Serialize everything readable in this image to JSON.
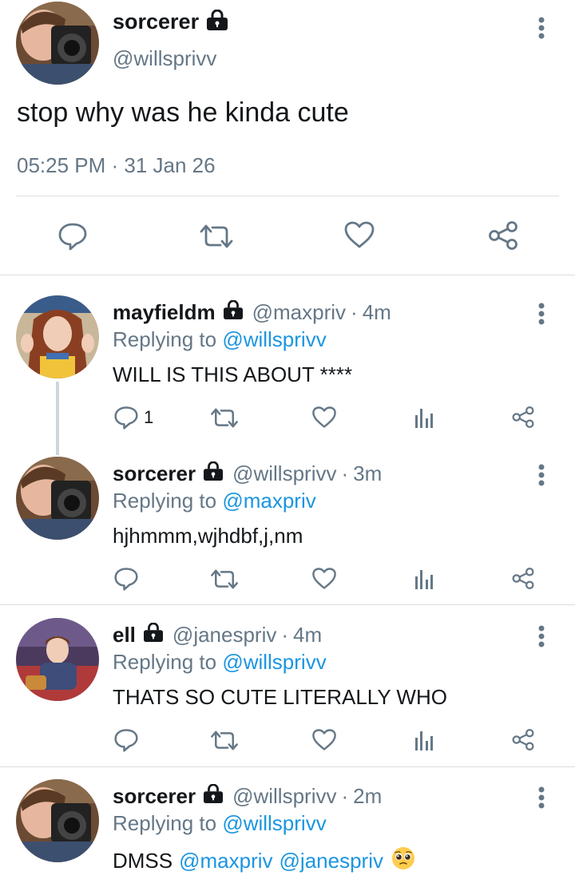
{
  "main_tweet": {
    "name": "sorcerer",
    "handle": "@willsprivv",
    "text": "stop why was he kinda cute",
    "timestamp": "05:25 PM · 31 Jan 26",
    "icons": [
      "lock-icon",
      "more-icon",
      "reply-icon",
      "retweet-icon",
      "like-icon",
      "share-icon"
    ]
  },
  "replies": [
    {
      "name": "mayfieldm",
      "handle": "@maxpriv",
      "dot": "·",
      "ago": "4m",
      "replying_prefix": "Replying to",
      "replying_to": "@willsprivv",
      "text": "WILL IS THIS ABOUT ****",
      "reply_count": "1"
    },
    {
      "name": "sorcerer",
      "handle": "@willsprivv",
      "dot": "·",
      "ago": "3m",
      "replying_prefix": "Replying to",
      "replying_to": "@maxpriv",
      "text": "hjhmmm,wjhdbf,j,nm",
      "reply_count": ""
    },
    {
      "name": "ell",
      "handle": "@janespriv",
      "dot": "·",
      "ago": "4m",
      "replying_prefix": "Replying to",
      "replying_to": "@willsprivv",
      "text": "THATS SO CUTE LITERALLY WHO",
      "reply_count": ""
    },
    {
      "name": "sorcerer",
      "handle": "@willsprivv",
      "dot": "·",
      "ago": "2m",
      "replying_prefix": "Replying to",
      "replying_to": "@willsprivv",
      "text_plain": "DMSS",
      "mention_1": "@maxpriv",
      "mention_2": "@janespriv",
      "emoji": "pleading-face-emoji"
    }
  ],
  "colors": {
    "text": "#14171a",
    "secondary": "#657786",
    "link": "#1b95e0",
    "divider": "#d9dee2"
  }
}
